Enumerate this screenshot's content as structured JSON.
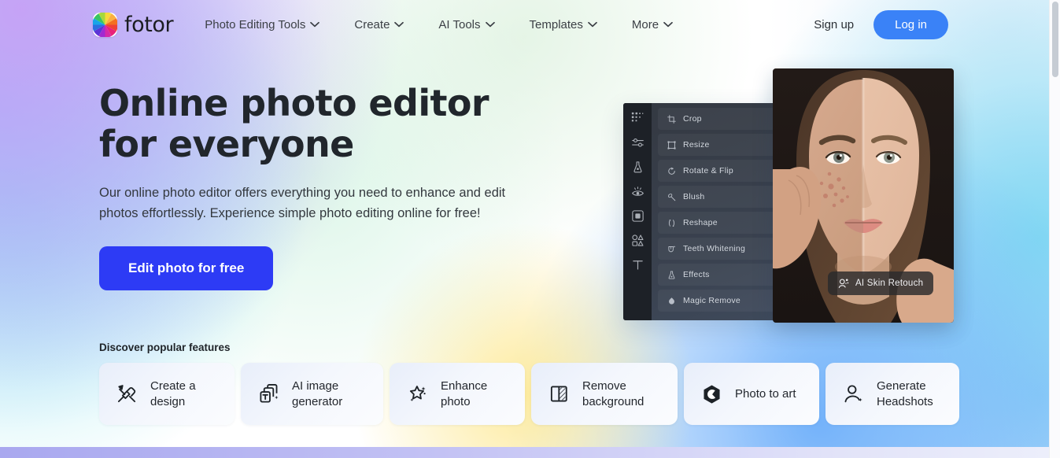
{
  "header": {
    "logo_text": "fotor",
    "logo_icon": "fotor-color-wheel-logo",
    "nav": [
      {
        "label": "Photo Editing Tools",
        "icon": "chevron-down-icon"
      },
      {
        "label": "Create",
        "icon": "chevron-down-icon"
      },
      {
        "label": "AI Tools",
        "icon": "chevron-down-icon"
      },
      {
        "label": "Templates",
        "icon": "chevron-down-icon"
      },
      {
        "label": "More",
        "icon": "chevron-down-icon"
      }
    ],
    "signup_label": "Sign up",
    "login_label": "Log in",
    "login_color": "#3a82f7"
  },
  "hero": {
    "title": "Online photo editor for everyone",
    "subtitle": "Our online photo editor offers everything you need to enhance and edit photos effortlessly. Experience simple photo editing online for free!",
    "cta_label": "Edit photo for free",
    "cta_color": "#2d3bf5"
  },
  "editor_mock": {
    "rail_icons": [
      "grid-dots-icon",
      "sliders-icon",
      "beauty-retouch-icon",
      "eye-icon",
      "frame-icon",
      "stickers-icon",
      "text-tool-icon"
    ],
    "menu": [
      {
        "label": "Crop",
        "icon": "crop-icon"
      },
      {
        "label": "Resize",
        "icon": "resize-icon"
      },
      {
        "label": "Rotate & Flip",
        "icon": "rotate-icon"
      },
      {
        "label": "Blush",
        "icon": "blush-icon"
      },
      {
        "label": "Reshape",
        "icon": "reshape-icon"
      },
      {
        "label": "Teeth Whitening",
        "icon": "teeth-icon"
      },
      {
        "label": "Effects",
        "icon": "effects-icon"
      },
      {
        "label": "Magic Remove",
        "icon": "magic-remove-icon"
      }
    ]
  },
  "portrait": {
    "badge_label": "AI Skin Retouch",
    "badge_icon": "ai-skin-retouch-icon",
    "alt": "before-after-face-retouch-photo"
  },
  "features": {
    "label": "Discover popular features",
    "cards": [
      {
        "label": "Create a\ndesign",
        "icon": "pencil-ruler-icon",
        "width": 172
      },
      {
        "label": "AI image\ngenerator",
        "icon": "ai-image-cards-icon",
        "width": 181
      },
      {
        "label": "Enhance\nphoto",
        "icon": "magic-wand-icon",
        "width": 172
      },
      {
        "label": "Remove\nbackground",
        "icon": "remove-bg-icon",
        "width": 186
      },
      {
        "label": "Photo to art",
        "icon": "photo-to-art-icon",
        "width": 172
      },
      {
        "label": "Generate\nHeadshots",
        "icon": "headshot-icon",
        "width": 170
      }
    ]
  },
  "scrollbar": {
    "name": "vertical-scrollbar"
  }
}
